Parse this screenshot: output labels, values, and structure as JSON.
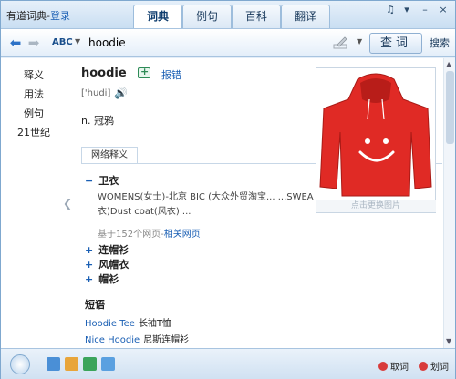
{
  "app": {
    "title": "有道词典-",
    "login_link": "登录"
  },
  "tabs": [
    {
      "label": "词典",
      "active": true
    },
    {
      "label": "例句",
      "active": false
    },
    {
      "label": "百科",
      "active": false
    },
    {
      "label": "翻译",
      "active": false
    }
  ],
  "window_controls": {
    "skin": "♫",
    "menu": "▾",
    "minimize": "–",
    "close": "×"
  },
  "search": {
    "abc_label": "ABC",
    "value": "hoodie",
    "lookup_button": "查词",
    "search_button": "搜索"
  },
  "sidebar": {
    "items": [
      "释义",
      "用法",
      "例句",
      "21世纪"
    ]
  },
  "entry": {
    "headword": "hoodie",
    "report_link": "报错",
    "phonetic": "['hudi]",
    "meaning": "n. 冠鸦"
  },
  "net_definitions": {
    "tab_label": "网络释义",
    "items": [
      {
        "sign": "−",
        "title": "卫衣"
      },
      {
        "sign": "+",
        "title": "连帽衫"
      },
      {
        "sign": "+",
        "title": "风帽衣"
      },
      {
        "sign": "+",
        "title": "帽衫"
      }
    ],
    "example_line1": "WOMENS(女士)-北京  BIC (大众外贸淘宝... ...SWEA",
    "example_line2": "衣)Dust coat(风衣) ...",
    "based_on_prefix": "基于152个网页-",
    "based_on_link": "相关网页"
  },
  "phrases": {
    "title": "短语",
    "items": [
      {
        "en": "Hoodie Tee",
        "zh": "长袖T恤"
      },
      {
        "en": "Nice Hoodie",
        "zh": "尼斯连帽衫"
      }
    ]
  },
  "image_panel": {
    "caption": "点击更换图片"
  },
  "bottom": {
    "toggle_lookup": "取词",
    "toggle_select": "划词"
  },
  "colors": {
    "accent": "#1a5fb4",
    "hoodie_red": "#e02a25",
    "toggle_red": "#d83b3b"
  }
}
